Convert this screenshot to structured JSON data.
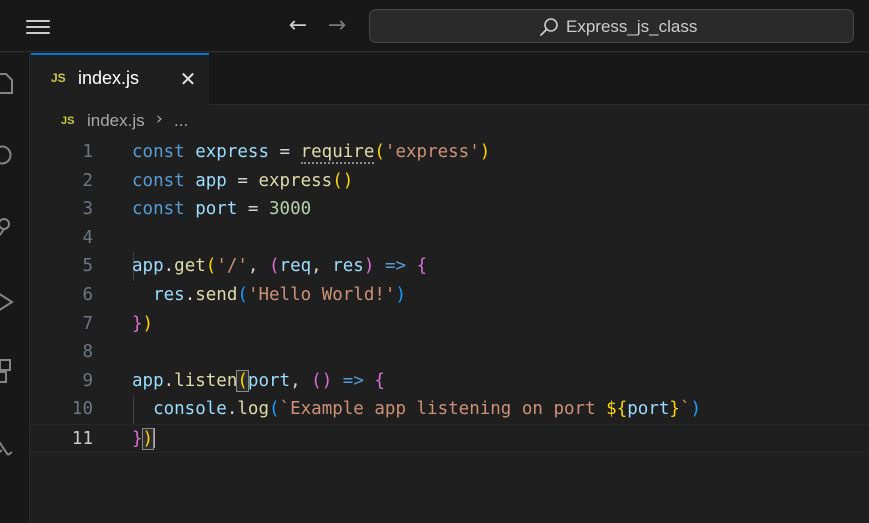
{
  "titlebar": {
    "search_text": "Express_js_class"
  },
  "icons": {
    "menu": "menu-icon",
    "back": "arrow-left-icon",
    "forward": "arrow-right-icon",
    "search": "search-icon",
    "activity": [
      "explorer-icon",
      "search-icon",
      "source-control-icon",
      "run-debug-icon",
      "extensions-icon",
      "test-icon"
    ]
  },
  "tab": {
    "badge": "JS",
    "label": "index.js",
    "close": "✕"
  },
  "breadcrumb": {
    "badge": "JS",
    "file": "index.js",
    "separator": "›",
    "more": "..."
  },
  "editor": {
    "active_line": 11,
    "line_numbers": [
      "1",
      "2",
      "3",
      "4",
      "5",
      "6",
      "7",
      "8",
      "9",
      "10",
      "11"
    ],
    "lines": [
      [
        {
          "t": "const",
          "c": "k"
        },
        {
          "t": " ",
          "c": "p"
        },
        {
          "t": "express",
          "c": "v"
        },
        {
          "t": " = ",
          "c": "p"
        },
        {
          "t": "require",
          "c": "f",
          "hint": true
        },
        {
          "t": "(",
          "c": "b1"
        },
        {
          "t": "'express'",
          "c": "s"
        },
        {
          "t": ")",
          "c": "b1"
        }
      ],
      [
        {
          "t": "const",
          "c": "k"
        },
        {
          "t": " ",
          "c": "p"
        },
        {
          "t": "app",
          "c": "v"
        },
        {
          "t": " = ",
          "c": "p"
        },
        {
          "t": "express",
          "c": "f"
        },
        {
          "t": "()",
          "c": "b1"
        }
      ],
      [
        {
          "t": "const",
          "c": "k"
        },
        {
          "t": " ",
          "c": "p"
        },
        {
          "t": "port",
          "c": "v"
        },
        {
          "t": " = ",
          "c": "p"
        },
        {
          "t": "3000",
          "c": "n"
        }
      ],
      [],
      [
        {
          "t": "app",
          "c": "v"
        },
        {
          "t": ".",
          "c": "p"
        },
        {
          "t": "get",
          "c": "f"
        },
        {
          "t": "(",
          "c": "b1"
        },
        {
          "t": "'/'",
          "c": "s"
        },
        {
          "t": ", ",
          "c": "p"
        },
        {
          "t": "(",
          "c": "b2"
        },
        {
          "t": "req",
          "c": "v"
        },
        {
          "t": ", ",
          "c": "p"
        },
        {
          "t": "res",
          "c": "v"
        },
        {
          "t": ")",
          "c": "b2"
        },
        {
          "t": " ",
          "c": "p"
        },
        {
          "t": "=>",
          "c": "k"
        },
        {
          "t": " ",
          "c": "p"
        },
        {
          "t": "{",
          "c": "b2"
        }
      ],
      [
        {
          "t": "  ",
          "c": "p"
        },
        {
          "t": "res",
          "c": "v"
        },
        {
          "t": ".",
          "c": "p"
        },
        {
          "t": "send",
          "c": "f"
        },
        {
          "t": "(",
          "c": "b3"
        },
        {
          "t": "'Hello World!'",
          "c": "s"
        },
        {
          "t": ")",
          "c": "b3"
        }
      ],
      [
        {
          "t": "}",
          "c": "b2"
        },
        {
          "t": ")",
          "c": "b1"
        }
      ],
      [],
      [
        {
          "t": "app",
          "c": "v"
        },
        {
          "t": ".",
          "c": "p"
        },
        {
          "t": "listen",
          "c": "f"
        },
        {
          "t": "(",
          "c": "b1",
          "match": true
        },
        {
          "t": "port",
          "c": "v"
        },
        {
          "t": ", ",
          "c": "p"
        },
        {
          "t": "()",
          "c": "b2"
        },
        {
          "t": " ",
          "c": "p"
        },
        {
          "t": "=>",
          "c": "k"
        },
        {
          "t": " ",
          "c": "p"
        },
        {
          "t": "{",
          "c": "b2"
        }
      ],
      [
        {
          "t": "  ",
          "c": "p"
        },
        {
          "t": "console",
          "c": "v"
        },
        {
          "t": ".",
          "c": "p"
        },
        {
          "t": "log",
          "c": "f"
        },
        {
          "t": "(",
          "c": "b3"
        },
        {
          "t": "`Example app listening on port ",
          "c": "s"
        },
        {
          "t": "${",
          "c": "b1"
        },
        {
          "t": "port",
          "c": "v"
        },
        {
          "t": "}",
          "c": "b1"
        },
        {
          "t": "`",
          "c": "s"
        },
        {
          "t": ")",
          "c": "b3"
        }
      ],
      [
        {
          "t": "}",
          "c": "b2"
        },
        {
          "t": ")",
          "c": "b1",
          "match": true
        },
        {
          "cursor": true
        }
      ]
    ]
  }
}
